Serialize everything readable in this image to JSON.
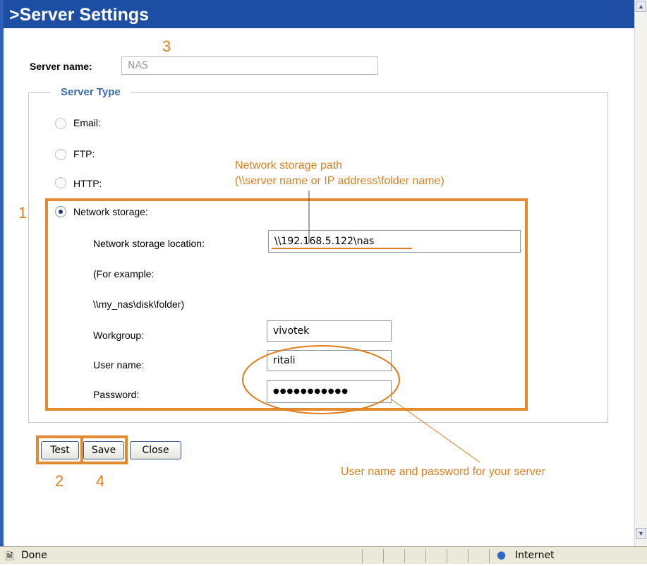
{
  "header": {
    "title": ">Server Settings"
  },
  "server_name": {
    "label": "Server name:",
    "value": "NAS"
  },
  "server_type": {
    "legend": "Server Type",
    "options": [
      {
        "label": "Email:",
        "checked": false
      },
      {
        "label": "FTP:",
        "checked": false
      },
      {
        "label": "HTTP:",
        "checked": false
      },
      {
        "label": "Network storage:",
        "checked": true
      }
    ]
  },
  "network_storage": {
    "location_label": "Network storage location:",
    "location_value": "\\\\192.168.5.122\\nas",
    "example_line1": "(For example:",
    "example_line2": "\\\\my_nas\\disk\\folder)",
    "workgroup_label": "Workgroup:",
    "workgroup_value": "vivotek",
    "username_label": "User name:",
    "username_value": "ritali",
    "password_label": "Password:",
    "password_value": "●●●●●●●●●●●"
  },
  "buttons": {
    "test": "Test",
    "save": "Save",
    "close": "Close"
  },
  "annotations": {
    "path_title": "Network storage path",
    "path_desc": "(\\\\server name or IP address\\folder name)",
    "credentials_note": "User name and password for your server",
    "num1": "1",
    "num2": "2",
    "num3": "3",
    "num4": "4"
  },
  "statusbar": {
    "status": "Done",
    "zone": "Internet"
  },
  "colors": {
    "header_bg": "#1c4fa3",
    "callout": "#e07e1e",
    "legend": "#3a6ab3"
  }
}
